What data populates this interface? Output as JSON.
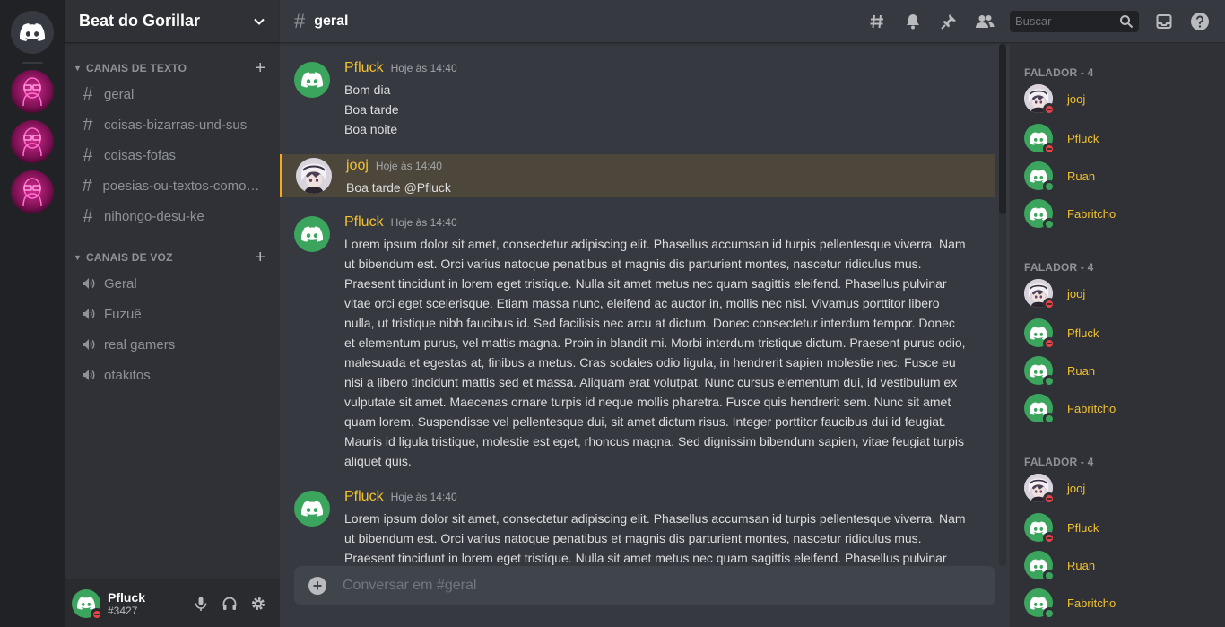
{
  "server": {
    "name": "Beat do Gorillar"
  },
  "channels": {
    "text_category": "CANAIS DE TEXTO",
    "text": [
      "geral",
      "coisas-bizarras-und-sus",
      "coisas-fofas",
      "poesias-ou-textos-comovente",
      "nihongo-desu-ke"
    ],
    "voice_category": "CANAIS DE VOZ",
    "voice": [
      "Geral",
      "Fuzuê",
      "real gamers",
      "otakitos"
    ]
  },
  "user_panel": {
    "name": "Pfluck",
    "tag": "#3427"
  },
  "header": {
    "channel": "geral",
    "search_placeholder": "Buscar"
  },
  "messages": [
    {
      "author": "Pfluck",
      "time": "Hoje às 14:40",
      "lines": [
        "Bom dia",
        "Boa tarde",
        "Boa noite"
      ]
    },
    {
      "author": "jooj",
      "time": "Hoje às 14:40",
      "lines": [
        "Boa tarde @Pfluck"
      ]
    },
    {
      "author": "Pfluck",
      "time": "Hoje às 14:40",
      "lines": [
        "Lorem ipsum dolor sit amet, consectetur adipiscing elit. Phasellus accumsan id turpis pellentesque viverra. Nam",
        "ut bibendum est. Orci varius natoque penatibus et magnis dis parturient montes, nascetur ridiculus mus.",
        "Praesent tincidunt in lorem eget tristique. Nulla sit amet metus nec quam sagittis eleifend. Phasellus pulvinar",
        "vitae orci eget scelerisque. Etiam massa nunc, eleifend ac auctor in, mollis nec nisl. Vivamus porttitor libero",
        "nulla, ut tristique nibh faucibus id. Sed facilisis nec arcu at dictum. Donec consectetur interdum tempor. Donec",
        "et elementum purus, vel mattis magna. Proin in blandit mi. Morbi interdum tristique dictum. Praesent purus odio,",
        "malesuada et egestas at, finibus a metus. Cras sodales odio ligula, in hendrerit sapien molestie nec. Fusce eu",
        "nisi a libero tincidunt mattis sed et massa. Aliquam erat volutpat. Nunc cursus elementum dui, id vestibulum ex",
        "vulputate sit amet. Maecenas ornare turpis id neque mollis pharetra. Fusce quis hendrerit sem. Nunc sit amet",
        "quam lorem. Suspendisse vel pellentesque dui, sit amet dictum risus. Integer porttitor faucibus dui id feugiat.",
        "Mauris id ligula tristique, molestie est eget, rhoncus magna. Sed dignissim bibendum sapien, vitae feugiat turpis",
        "aliquet quis."
      ]
    },
    {
      "author": "Pfluck",
      "time": "Hoje às 14:40",
      "lines": [
        "Lorem ipsum dolor sit amet, consectetur adipiscing elit. Phasellus accumsan id turpis pellentesque viverra. Nam",
        "ut bibendum est. Orci varius natoque penatibus et magnis dis parturient montes, nascetur ridiculus mus.",
        "Praesent tincidunt in lorem eget tristique. Nulla sit amet metus nec quam sagittis eleifend. Phasellus pulvinar"
      ]
    }
  ],
  "composer": {
    "placeholder": "Conversar em #geral"
  },
  "members": {
    "groups": [
      {
        "title": "FALADOR - 4",
        "members": [
          {
            "name": "jooj",
            "status": "dnd"
          },
          {
            "name": "Pfluck",
            "status": "dnd"
          },
          {
            "name": "Ruan",
            "status": "online"
          },
          {
            "name": "Fabritcho",
            "status": "online"
          }
        ]
      },
      {
        "title": "FALADOR - 4",
        "members": [
          {
            "name": "jooj",
            "status": "dnd"
          },
          {
            "name": "Pfluck",
            "status": "dnd"
          },
          {
            "name": "Ruan",
            "status": "online"
          },
          {
            "name": "Fabritcho",
            "status": "online"
          }
        ]
      },
      {
        "title": "FALADOR - 4",
        "members": [
          {
            "name": "jooj",
            "status": "dnd"
          },
          {
            "name": "Pfluck",
            "status": "dnd"
          },
          {
            "name": "Ruan",
            "status": "online"
          },
          {
            "name": "Fabritcho",
            "status": "online"
          }
        ]
      }
    ]
  },
  "colors": {
    "accent_green": "#3ba55d",
    "author_gold": "#f2c12e",
    "dnd_red": "#ed4245",
    "mention_bar": "#faa81a"
  }
}
